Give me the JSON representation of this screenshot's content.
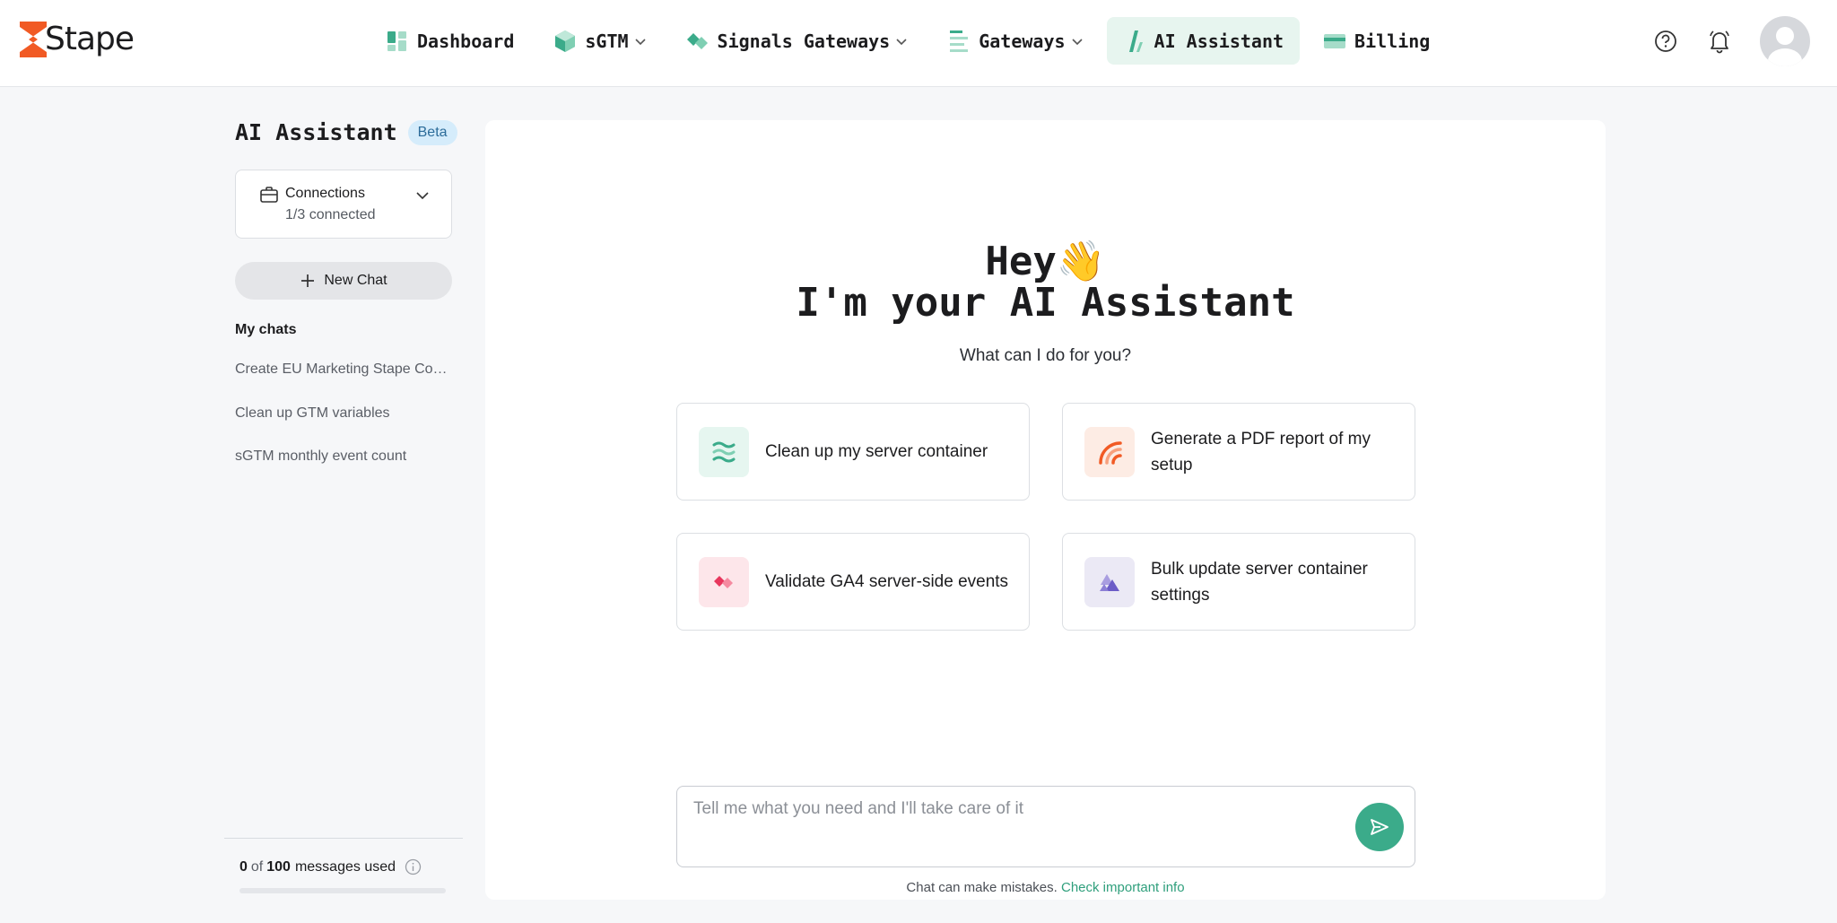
{
  "brand": {
    "name": "Stape"
  },
  "nav": {
    "items": [
      {
        "label": "Dashboard",
        "icon": "dashboard-icon"
      },
      {
        "label": "sGTM",
        "icon": "cube-icon",
        "has_dropdown": true
      },
      {
        "label": "Signals Gateways",
        "icon": "signals-icon",
        "has_dropdown": true
      },
      {
        "label": "Gateways",
        "icon": "gateways-icon",
        "has_dropdown": true
      },
      {
        "label": "AI Assistant",
        "icon": "ai-icon",
        "active": true
      },
      {
        "label": "Billing",
        "icon": "card-icon"
      }
    ]
  },
  "sidebar": {
    "title": "AI Assistant",
    "badge": "Beta",
    "connections": {
      "label": "Connections",
      "status": "1/3 connected"
    },
    "new_chat_label": "New Chat",
    "my_chats_label": "My chats",
    "chats": [
      "Create EU Marketing Stape Cont...",
      "Clean up GTM variables",
      "sGTM monthly event count"
    ],
    "usage": {
      "used": "0",
      "of_label": "of",
      "total": "100",
      "suffix": "messages used",
      "fraction": 0
    }
  },
  "main": {
    "greeting": "Hey",
    "greeting_emoji": "👋",
    "headline": "I'm your AI Assistant",
    "subhead": "What can I do for you?",
    "cards": [
      {
        "label": "Clean up my server container",
        "icon": "waves-icon",
        "bg": "#e6f6f0"
      },
      {
        "label": "Generate a PDF report of my setup",
        "icon": "signal-arc-icon",
        "bg": "#fdece4"
      },
      {
        "label": "Validate GA4 server-side events",
        "icon": "diamond-icon",
        "bg": "#fde6ea"
      },
      {
        "label": "Bulk update server container settings",
        "icon": "triangles-icon",
        "bg": "#ebe9f5"
      }
    ],
    "input_placeholder": "Tell me what you need and I'll take care of it",
    "disclaimer": "Chat can make mistakes.",
    "disclaimer_link": "Check important info"
  },
  "colors": {
    "accent": "#3bab8a",
    "active_nav_bg": "#e7f5ef",
    "beta_bg": "#d5ecfb",
    "logo_orange": "#f15a24"
  }
}
